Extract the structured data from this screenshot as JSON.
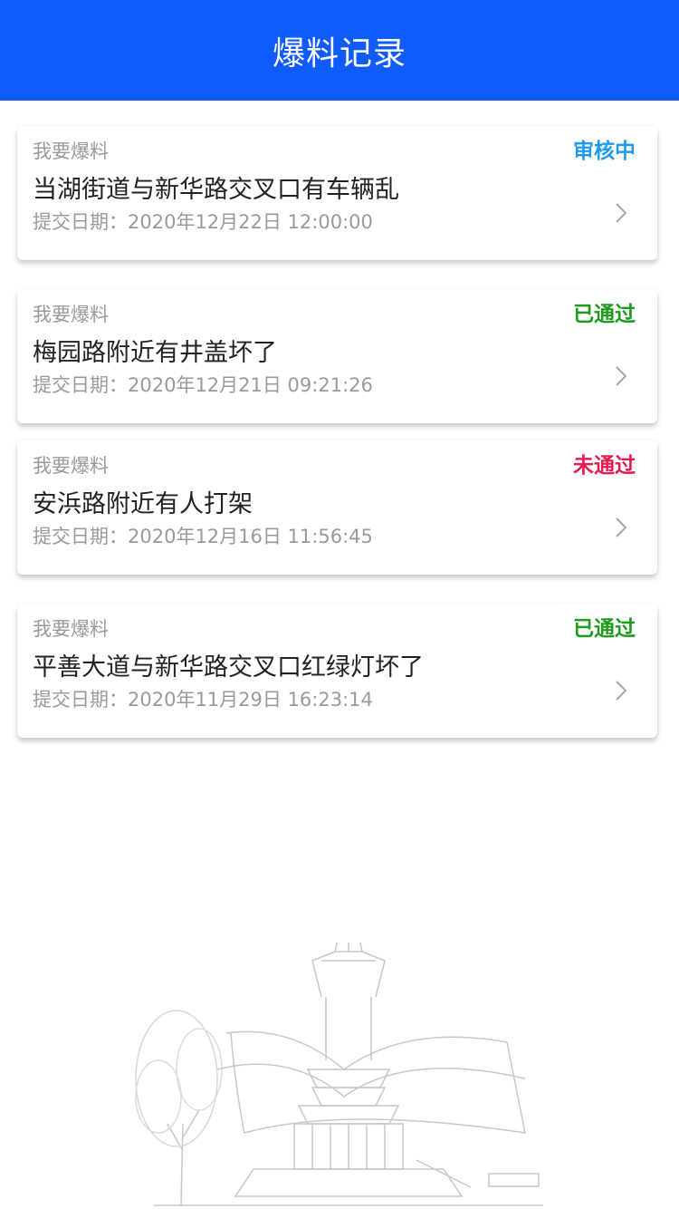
{
  "header": {
    "title": "爆料记录"
  },
  "records": [
    {
      "category": "我要爆料",
      "status": "审核中",
      "status_color": "#1e9bef",
      "title": "当湖街道与新华路交叉口有车辆乱",
      "date": "提交日期：2020年12月22日 12:00:00"
    },
    {
      "category": "我要爆料",
      "status": "已通过",
      "status_color": "#1e9a1e",
      "title": "梅园路附近有井盖坏了",
      "date": "提交日期：2020年12月21日 09:21:26"
    },
    {
      "category": "我要爆料",
      "status": "未通过",
      "status_color": "#e8194f",
      "title": "安浜路附近有人打架",
      "date": "提交日期：2020年12月16日 11:56:45"
    },
    {
      "category": "我要爆料",
      "status": "已通过",
      "status_color": "#1e9a1e",
      "title": "平善大道与新华路交叉口红绿灯坏了",
      "date": "提交日期：2020年11月29日 16:23:14"
    }
  ],
  "icons": {
    "chevron": "chevron-right-icon",
    "illustration": "building-sketch-illustration"
  },
  "colors": {
    "header_bg": "#0f5cfb",
    "muted_text": "#9a9a9a",
    "title_text": "#222222"
  }
}
